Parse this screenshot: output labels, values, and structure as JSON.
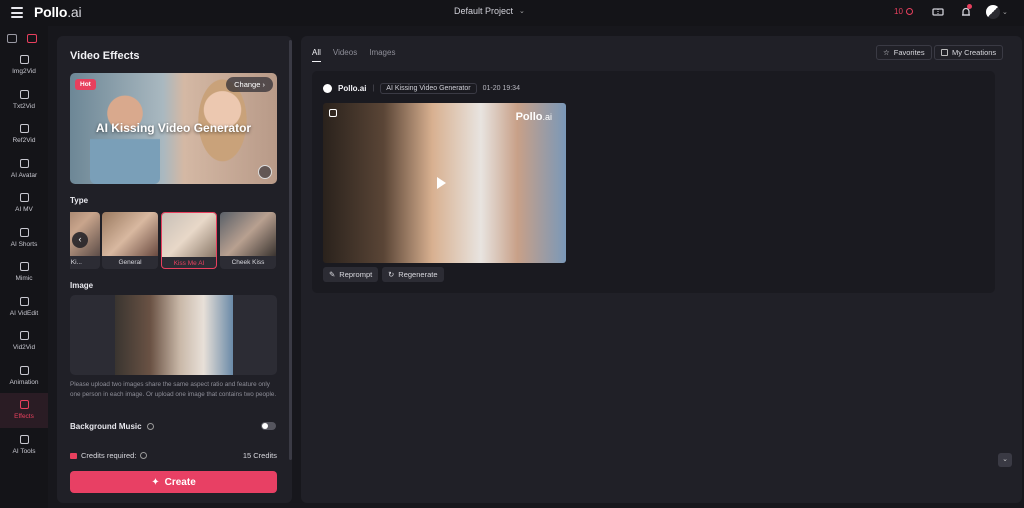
{
  "app": {
    "logo_main": "Pollo",
    "logo_suffix": ".ai"
  },
  "header": {
    "project_name": "Default Project",
    "credits": "10",
    "colors": {
      "accent": "#e8405e",
      "background": "#17171c"
    }
  },
  "rail": {
    "items": [
      {
        "label": "Img2Vid",
        "icon": "image-to-video-icon"
      },
      {
        "label": "Txt2Vid",
        "icon": "text-to-video-icon"
      },
      {
        "label": "Ref2Vid",
        "icon": "reference-video-icon"
      },
      {
        "label": "AI Avatar",
        "icon": "avatar-icon"
      },
      {
        "label": "AI MV",
        "icon": "music-video-icon"
      },
      {
        "label": "AI Shorts",
        "icon": "shorts-icon"
      },
      {
        "label": "Mimic",
        "icon": "mimic-icon"
      },
      {
        "label": "AI VidEdit",
        "icon": "video-edit-icon"
      },
      {
        "label": "Vid2Vid",
        "icon": "video-to-video-icon"
      },
      {
        "label": "Animation",
        "icon": "animation-icon"
      },
      {
        "label": "Effects",
        "icon": "effects-icon",
        "active": true
      },
      {
        "label": "AI Tools",
        "icon": "tools-icon"
      }
    ]
  },
  "panel": {
    "title": "Video Effects",
    "hero": {
      "badge": "Hot",
      "change_label": "Change",
      "title": "AI Kissing Video Generator"
    },
    "type_label": "Type",
    "types": [
      {
        "label": "ch Ki..."
      },
      {
        "label": "General"
      },
      {
        "label": "Kiss Me AI",
        "active": true
      },
      {
        "label": "Cheek Kiss"
      }
    ],
    "image_label": "Image",
    "hint": "Please upload two images share the same aspect ratio and feature only one person in each image. Or upload one image that contains two people.",
    "background_music_label": "Background Music",
    "background_music_on": false,
    "credits_label": "Credits required:",
    "credits_value": "15 Credits",
    "create_label": "Create"
  },
  "main": {
    "tabs": [
      {
        "label": "All",
        "active": true
      },
      {
        "label": "Videos"
      },
      {
        "label": "Images"
      }
    ],
    "favorites_label": "Favorites",
    "my_creations_label": "My Creations",
    "result": {
      "brand": "Pollo.ai",
      "tool": "AI Kissing Video Generator",
      "timestamp": "01-20 19:34",
      "watermark_main": "Pollo",
      "watermark_suffix": ".ai",
      "reprompt_label": "Reprompt",
      "regenerate_label": "Regenerate"
    }
  }
}
